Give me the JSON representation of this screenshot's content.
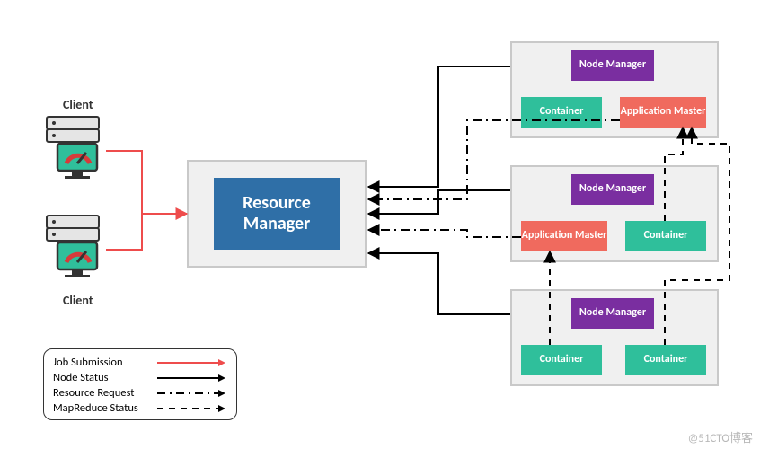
{
  "clients": {
    "top_label": "Client",
    "bottom_label": "Client"
  },
  "resource_manager": {
    "label": "Resource Manager"
  },
  "nodes": [
    {
      "node_manager": "Node Manager",
      "left_box": {
        "kind": "container",
        "label": "Container"
      },
      "right_box": {
        "kind": "application_master",
        "label": "Application Master"
      }
    },
    {
      "node_manager": "Node Manager",
      "left_box": {
        "kind": "application_master",
        "label": "Application Master"
      },
      "right_box": {
        "kind": "container",
        "label": "Container"
      }
    },
    {
      "node_manager": "Node Manager",
      "left_box": {
        "kind": "container",
        "label": "Container"
      },
      "right_box": {
        "kind": "container",
        "label": "Container"
      }
    }
  ],
  "legend": {
    "items": [
      {
        "label": "Job Submission",
        "style": "solid",
        "color": "#ee4c4c"
      },
      {
        "label": "Node Status",
        "style": "solid",
        "color": "#000000"
      },
      {
        "label": "Resource Request",
        "style": "dashdot",
        "color": "#000000"
      },
      {
        "label": "MapReduce Status",
        "style": "dash",
        "color": "#000000"
      }
    ]
  },
  "connections": [
    {
      "type": "job_submission",
      "from": "client-top",
      "to": "resource-manager"
    },
    {
      "type": "job_submission",
      "from": "client-bottom",
      "to": "resource-manager"
    },
    {
      "type": "node_status",
      "from": "node-1",
      "to": "resource-manager"
    },
    {
      "type": "node_status",
      "from": "node-2",
      "to": "resource-manager"
    },
    {
      "type": "node_status",
      "from": "node-3",
      "to": "resource-manager"
    },
    {
      "type": "resource_request",
      "from": "node-1.application-master",
      "to": "resource-manager"
    },
    {
      "type": "resource_request",
      "from": "node-2.application-master",
      "to": "resource-manager"
    },
    {
      "type": "mapreduce_status",
      "from": "node-2.container",
      "to": "node-1.application-master"
    },
    {
      "type": "mapreduce_status",
      "from": "node-3.container-left",
      "to": "node-2.application-master"
    },
    {
      "type": "mapreduce_status",
      "from": "node-3.container-right",
      "to": "node-1.application-master"
    }
  ],
  "watermark": "@51CTO博客"
}
